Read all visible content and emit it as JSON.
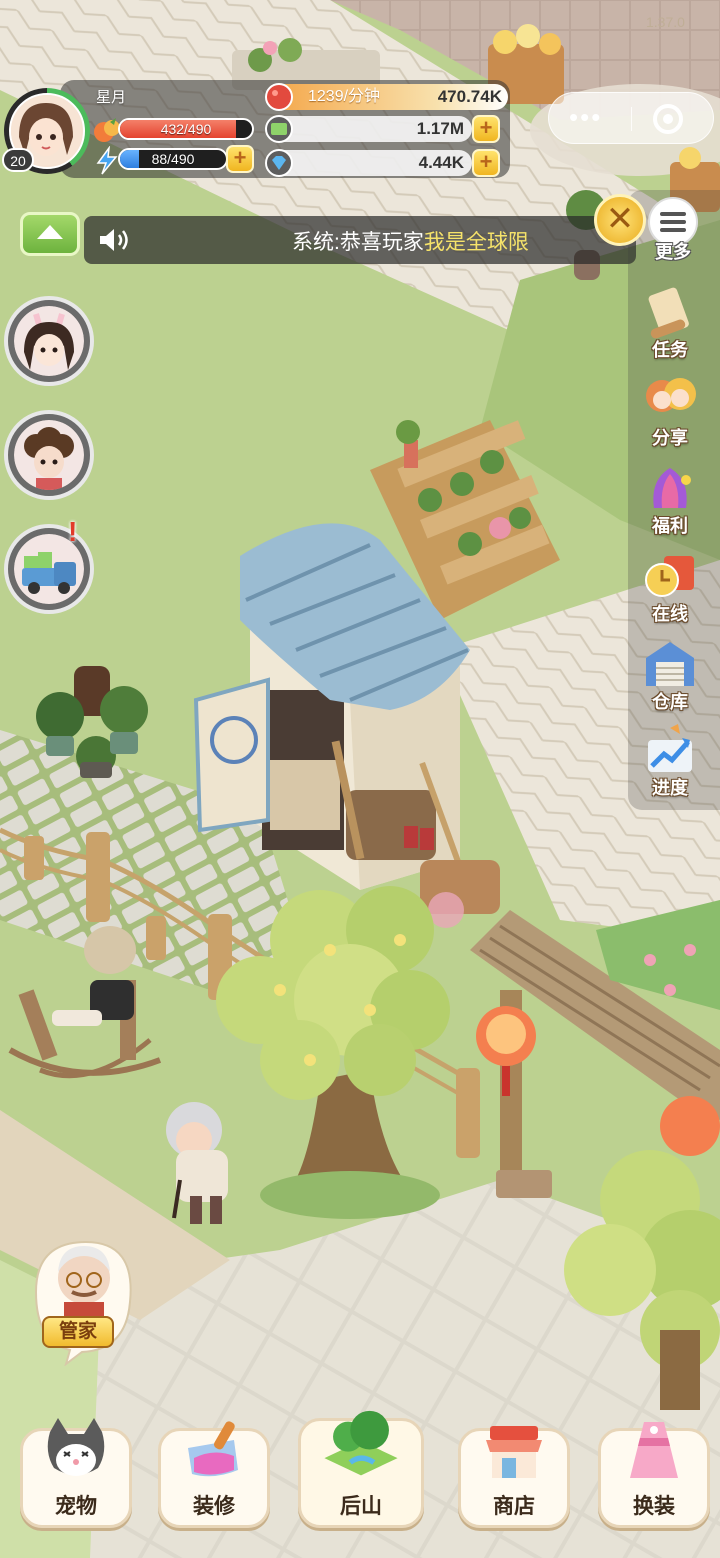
{
  "version": "1.37.0",
  "player": {
    "name": "星月",
    "level": "20",
    "stamina": "432/490",
    "stamina_fraction": 0.88,
    "energy": "88/490",
    "energy_fraction": 0.18
  },
  "resources": {
    "rate": "1239/分钟",
    "coins": "470.74K",
    "cash": "1.17M",
    "diamonds": "4.44K"
  },
  "notice": {
    "prefix": "系统:恭喜玩家",
    "highlight": "我是全球限"
  },
  "right_menu": {
    "more": "更多",
    "items": [
      "任务",
      "分享",
      "福利",
      "在线",
      "仓库",
      "进度"
    ]
  },
  "butler": {
    "label": "管家"
  },
  "bottom_nav": [
    "宠物",
    "装修",
    "后山",
    "商店",
    "换装"
  ],
  "colors": {
    "grass": "#b9cf8e",
    "path": "#e9e2d4",
    "stamina_bar": "#e9503c",
    "energy_bar": "#3d8ee8",
    "notice_highlight": "#f6e36a"
  }
}
